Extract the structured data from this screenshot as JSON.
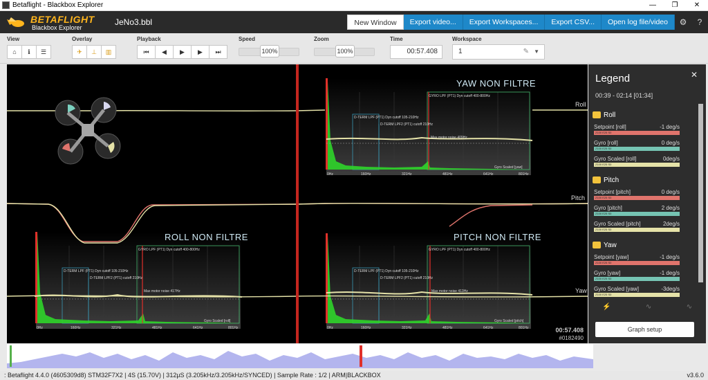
{
  "window": {
    "title": "Betaflight - Blackbox Explorer",
    "controls": [
      "—",
      "❐",
      "✕"
    ]
  },
  "header": {
    "brand": "BETAFLIGHT",
    "subtitle": "Blackbox Explorer",
    "filename": "JeNo3.bbl",
    "buttons": [
      "New Window",
      "Export video...",
      "Export Workspaces...",
      "Export CSV...",
      "Open log file/video"
    ],
    "icons": [
      "gear-icon",
      "help-icon"
    ]
  },
  "toolbar": {
    "view_label": "View",
    "overlay_label": "Overlay",
    "playback_label": "Playback",
    "speed_label": "Speed",
    "speed_value": "100%",
    "zoom_label": "Zoom",
    "zoom_value": "100%",
    "time_label": "Time",
    "time_value": "00:57.408",
    "workspace_label": "Workspace",
    "workspace_value": "1"
  },
  "graph": {
    "traces": [
      "Roll",
      "Pitch",
      "Yaw"
    ],
    "clock": "00:57.408",
    "frame": "#0182490",
    "panels": [
      {
        "title": "YAW NON FILTRE",
        "gyro_lpf": "GYRO LPF (PT1) Dyn cutoff 400-800Hz",
        "dterm1": "D-TERM LPF (PT1) Dyn cutoff 105-210Hz",
        "dterm2": "D-TERM LPF2 (PT1) cutoff 210Hz",
        "motor": "Max motor noise 409Hz",
        "axis_ticks": [
          "0Hz",
          "160Hz",
          "321Hz",
          "481Hz",
          "641Hz",
          "801Hz"
        ],
        "series": "Gyro Scaled [yaw]"
      },
      {
        "title": "ROLL NON FILTRE",
        "gyro_lpf": "GYRO LPF (PT1) Dyn cutoff 400-800Hz",
        "dterm1": "D-TERM LPF (PT1) Dyn cutoff 105-210Hz",
        "dterm2": "D-TERM LPF2 (PT1) cutoff 210Hz",
        "motor": "Max motor noise 417Hz",
        "axis_ticks": [
          "0Hz",
          "160Hz",
          "321Hz",
          "481Hz",
          "641Hz",
          "801Hz"
        ],
        "series": "Gyro Scaled [roll]"
      },
      {
        "title": "PITCH NON FILTRE",
        "gyro_lpf": "GYRO LPF (PT1) Dyn cutoff 400-800Hz",
        "dterm1": "D-TERM LPF (PT1) Dyn cutoff 105-210Hz",
        "dterm2": "D-TERM LPF2 (PT1) cutoff 210Hz",
        "motor": "Max motor noise 413Hz",
        "axis_ticks": [
          "0Hz",
          "160Hz",
          "321Hz",
          "481Hz",
          "641Hz",
          "801Hz"
        ],
        "series": "Gyro Scaled [pitch]"
      }
    ]
  },
  "legend": {
    "title": "Legend",
    "close": "✕",
    "range": "00:39 - 02:14 [01:34]",
    "groups": [
      {
        "name": "Roll",
        "items": [
          {
            "name": "Setpoint [roll]",
            "value": "-1 deg/s",
            "bar": "Z100 E25 S0",
            "color": "#e0746c"
          },
          {
            "name": "Gyro [roll]",
            "value": "0 deg/s",
            "bar": "Z100 E25 S0",
            "color": "#76c4b3"
          },
          {
            "name": "Gyro Scaled [roll]",
            "value": "0deg/s",
            "bar": "Z100 E25 S0",
            "color": "#e5e2a8"
          }
        ]
      },
      {
        "name": "Pitch",
        "items": [
          {
            "name": "Setpoint [pitch]",
            "value": "0 deg/s",
            "bar": "Z100 E25 S0",
            "color": "#e0746c"
          },
          {
            "name": "Gyro [pitch]",
            "value": "2 deg/s",
            "bar": "Z100 E25 S0",
            "color": "#76c4b3"
          },
          {
            "name": "Gyro Scaled [pitch]",
            "value": "2deg/s",
            "bar": "Z100 E25 S0",
            "color": "#e5e2a8"
          }
        ]
      },
      {
        "name": "Yaw",
        "items": [
          {
            "name": "Setpoint [yaw]",
            "value": "-1 deg/s",
            "bar": "Z100 E25 S0",
            "color": "#e0746c"
          },
          {
            "name": "Gyro [yaw]",
            "value": "-1 deg/s",
            "bar": "Z100 E25 S0",
            "color": "#76c4b3"
          },
          {
            "name": "Gyro Scaled [yaw]",
            "value": "-3deg/s",
            "bar": "Z100 E25 S0",
            "color": "#e5e2a8"
          }
        ]
      }
    ],
    "graph_setup": "Graph setup"
  },
  "status": {
    "text": ": Betaflight 4.4.0 (4605309d8) STM32F7X2 | 4S (15.70V) | 312µS (3.205kHz/3.205kHz/SYNCED) | Sample Rate : 1/2 | ARM|BLACKBOX",
    "version": "v3.6.0"
  }
}
